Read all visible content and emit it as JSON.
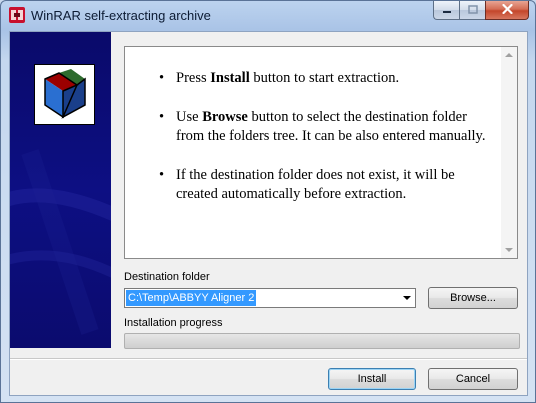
{
  "window": {
    "title": "WinRAR self-extracting archive"
  },
  "info": {
    "bullets": [
      {
        "pre": "Press ",
        "bold": "Install",
        "post": " button to start extraction."
      },
      {
        "pre": "Use ",
        "bold": "Browse",
        "post": " button to select the destination folder from the folders tree. It can be also entered manually."
      },
      {
        "pre": "",
        "bold": "",
        "post": "If the destination folder does not exist, it will be created automatically before extraction."
      }
    ]
  },
  "destination": {
    "label": "Destination folder",
    "value": "C:\\Temp\\ABBYY Aligner 2",
    "browse_label": "Browse..."
  },
  "progress": {
    "label": "Installation progress",
    "value": 0
  },
  "actions": {
    "install_label": "Install",
    "cancel_label": "Cancel"
  },
  "icons": {
    "app": "winrar-icon",
    "logo": "winrar-books-icon",
    "minimize": "minimize-icon",
    "maximize": "maximize-icon",
    "close": "close-icon"
  }
}
